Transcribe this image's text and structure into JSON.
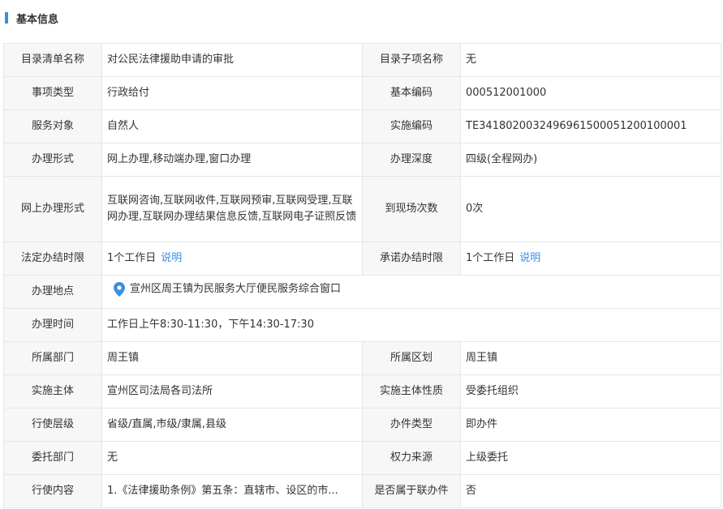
{
  "section": {
    "title": "基本信息",
    "accent_color": "#3a8ee6"
  },
  "rows": [
    {
      "l1": "目录清单名称",
      "v1": "对公民法律援助申请的审批",
      "l2": "目录子项名称",
      "v2": "无"
    },
    {
      "l1": "事项类型",
      "v1": "行政给付",
      "l2": "基本编码",
      "v2": "000512001000"
    },
    {
      "l1": "服务对象",
      "v1": "自然人",
      "l2": "实施编码",
      "v2": "TE341802003249696150005120010000​1"
    },
    {
      "l1": "办理形式",
      "v1": "网上办理,移动端办理,窗口办理",
      "l2": "办理深度",
      "v2": "四级(全程网办)"
    },
    {
      "l1": "网上办理形式",
      "v1": "互联网咨询,互联网收件,互联网预审,互联网受理,互联网办理,互联网办理结果信息反馈,互联网电子证照反馈",
      "l2": "到现场次数",
      "v2": "0次"
    },
    {
      "l1": "法定办结时限",
      "v1": "1个工作日",
      "link1": "说明",
      "l2": "承诺办结时限",
      "v2": "1个工作日",
      "link2": "说明"
    }
  ],
  "location": {
    "label": "办理地点",
    "value": "宣州区周王镇为民服务大厅便民服务综合窗口",
    "icon": "map-pin-icon",
    "icon_color": "#3a8ee6"
  },
  "hours": {
    "label": "办理时间",
    "value": "工作日上午8:30-11:30，下午14:30-17:30"
  },
  "rows2": [
    {
      "l1": "所属部门",
      "v1": "周王镇",
      "l2": "所属区划",
      "v2": "周王镇"
    },
    {
      "l1": "实施主体",
      "v1": "宣州区司法局各司法所",
      "l2": "实施主体性质",
      "v2": "受委托组织"
    },
    {
      "l1": "行使层级",
      "v1": "省级/直属,市级/隶属,县级",
      "l2": "办件类型",
      "v2": "即办件"
    },
    {
      "l1": "委托部门",
      "v1": "无",
      "l2": "权力来源",
      "v2": "上级委托"
    },
    {
      "l1": "行使内容",
      "v1": "1.《法律援助条例》第五条：直辖市、设区的市...",
      "l2": "是否属于联办件",
      "v2": "否"
    }
  ]
}
